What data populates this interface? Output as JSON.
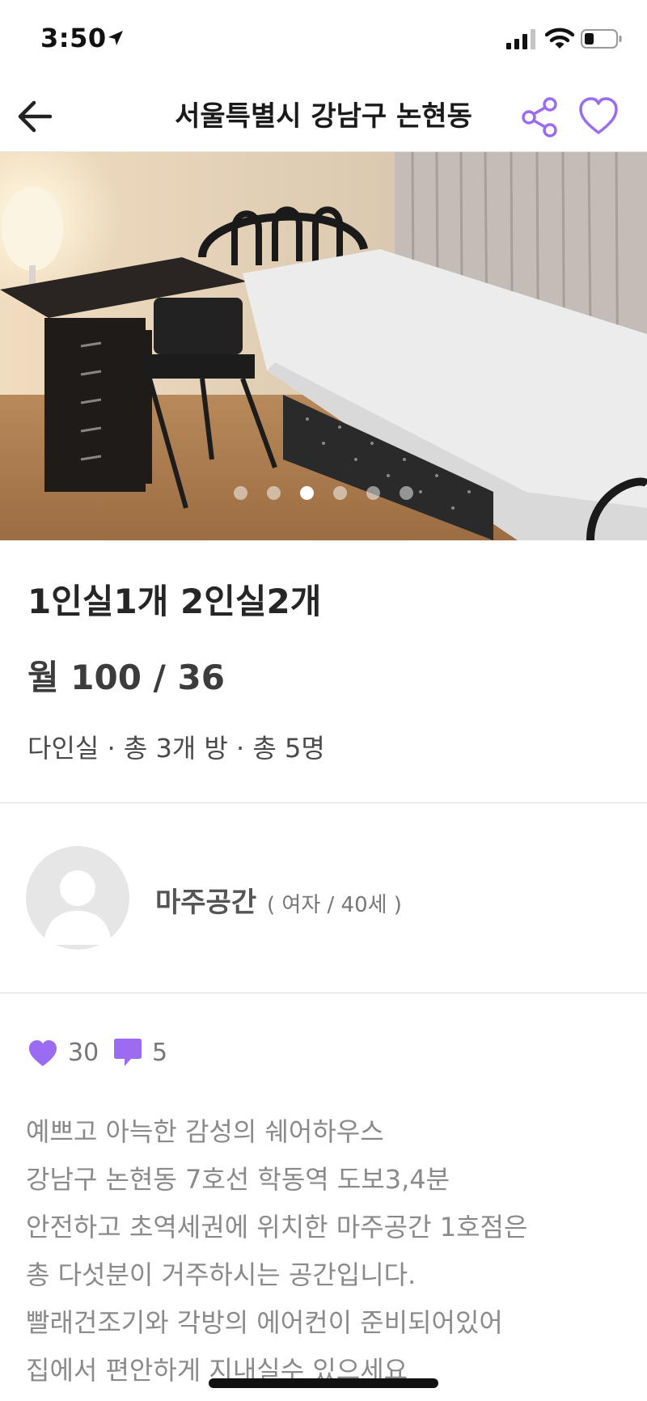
{
  "status_bar": {
    "time": "3:50",
    "icons": [
      "location-arrow-icon",
      "cellular-signal-icon",
      "wifi-icon",
      "battery-icon"
    ]
  },
  "nav": {
    "title": "서울특별시 강남구 논현동",
    "back_icon": "back-arrow-icon",
    "share_icon": "share-icon",
    "favorite_icon": "heart-outline-icon",
    "accent_color": "#9b6cf2"
  },
  "gallery": {
    "page_count": 6,
    "active_index": 2
  },
  "listing": {
    "title": "1인실1개 2인실2개",
    "price": "월 100 / 36",
    "meta": "다인실 · 총 3개 방 · 총 5명"
  },
  "host": {
    "name": "마주공간",
    "detail": "( 여자 / 40세 )"
  },
  "stats": {
    "likes": "30",
    "comments": "5",
    "color": "#9b6cf2"
  },
  "description": {
    "lines": [
      "예쁘고 아늑한 감성의 쉐어하우스",
      "강남구 논현동 7호선 학동역 도보3,4분",
      "안전하고 초역세권에 위치한 마주공간 1호점은",
      "총 다섯분이 거주하시는 공간입니다.",
      "빨래건조기와 각방의 에어컨이 준비되어있어",
      "집에서 편안하게 지내실수 있으세요"
    ]
  }
}
